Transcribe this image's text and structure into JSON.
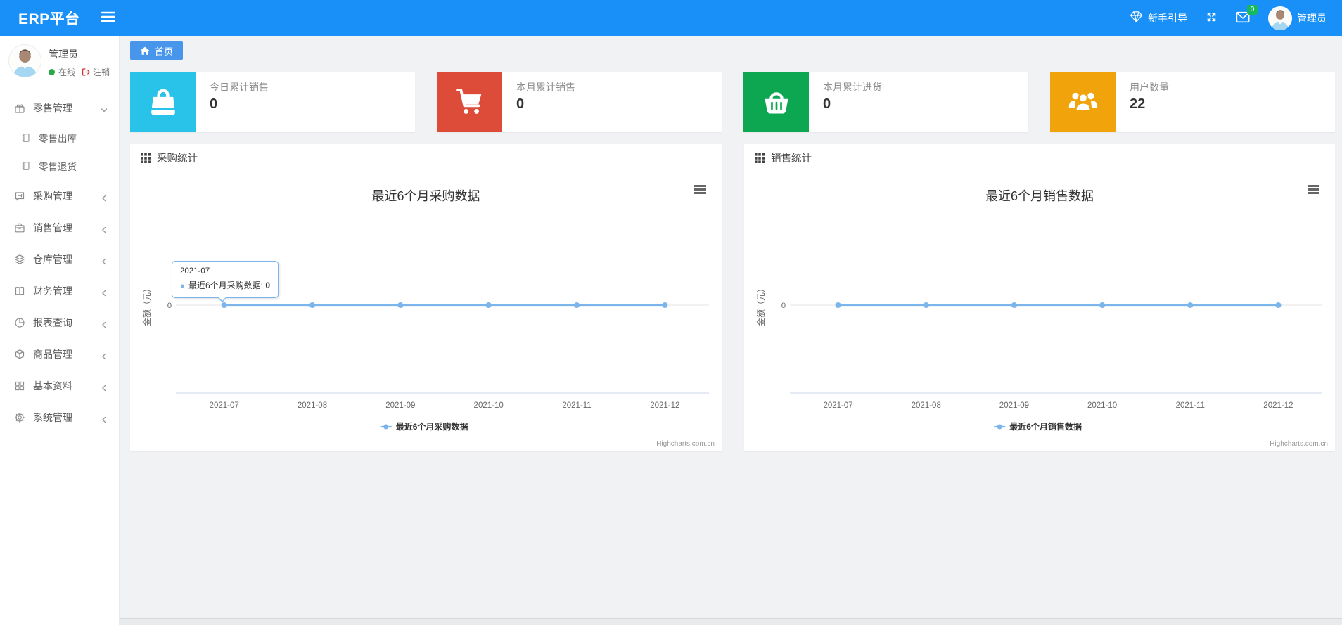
{
  "navbar": {
    "brand": "ERP平台",
    "guide_label": "新手引导",
    "mail_badge": "0",
    "username": "管理员"
  },
  "sidebar": {
    "user": {
      "name": "管理员",
      "status": "在线",
      "logout": "注销"
    },
    "menu": [
      {
        "label": "零售管理"
      },
      {
        "label": "零售出库"
      },
      {
        "label": "零售退货"
      },
      {
        "label": "采购管理"
      },
      {
        "label": "销售管理"
      },
      {
        "label": "仓库管理"
      },
      {
        "label": "财务管理"
      },
      {
        "label": "报表查询"
      },
      {
        "label": "商品管理"
      },
      {
        "label": "基本资料"
      },
      {
        "label": "系统管理"
      }
    ]
  },
  "tabs": {
    "home": "首页"
  },
  "stat_cards": [
    {
      "label": "今日累计销售",
      "value": "0",
      "color": "#29c2e8",
      "icon": "shopping-bag-icon"
    },
    {
      "label": "本月累计销售",
      "value": "0",
      "color": "#dd4c39",
      "icon": "cart-icon"
    },
    {
      "label": "本月累计进货",
      "value": "0",
      "color": "#0ca750",
      "icon": "basket-icon"
    },
    {
      "label": "用户数量",
      "value": "22",
      "color": "#f0a30a",
      "icon": "users-icon"
    }
  ],
  "panels": [
    {
      "title": "采购统计"
    },
    {
      "title": "销售统计"
    }
  ],
  "chart_data": [
    {
      "type": "line",
      "title": "最近6个月采购数据",
      "categories": [
        "2021-07",
        "2021-08",
        "2021-09",
        "2021-10",
        "2021-11",
        "2021-12"
      ],
      "series": [
        {
          "name": "最近6个月采购数据",
          "values": [
            0,
            0,
            0,
            0,
            0,
            0
          ]
        }
      ],
      "xlabel": "",
      "ylabel": "金额（元）",
      "yticks": [
        0
      ],
      "ylim": [
        0,
        0
      ],
      "grid": true,
      "legend_position": "bottom",
      "line_color": "#7cb5ec",
      "credit": "Highcharts.com.cn",
      "tooltip": {
        "visible": true,
        "category": "2021-07",
        "label": "最近6个月采购数据:",
        "value": "0"
      }
    },
    {
      "type": "line",
      "title": "最近6个月销售数据",
      "categories": [
        "2021-07",
        "2021-08",
        "2021-09",
        "2021-10",
        "2021-11",
        "2021-12"
      ],
      "series": [
        {
          "name": "最近6个月销售数据",
          "values": [
            0,
            0,
            0,
            0,
            0,
            0
          ]
        }
      ],
      "xlabel": "",
      "ylabel": "金额（元）",
      "yticks": [
        0
      ],
      "ylim": [
        0,
        0
      ],
      "grid": true,
      "legend_position": "bottom",
      "line_color": "#7cb5ec",
      "credit": "Highcharts.com.cn",
      "tooltip": {
        "visible": false
      }
    }
  ]
}
